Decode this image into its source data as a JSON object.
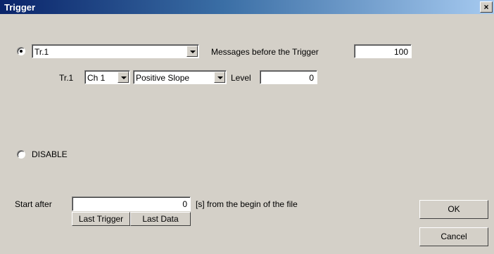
{
  "window": {
    "title": "Trigger",
    "close_glyph": "×"
  },
  "trigger": {
    "selected": true,
    "select_value": "Tr.1",
    "messages_label": "Messages before the Trigger",
    "messages_value": "100",
    "row_label": "Tr.1",
    "channel_value": "Ch 1",
    "slope_value": "Positive Slope",
    "level_label": "Level",
    "level_value": "0"
  },
  "disable": {
    "selected": false,
    "label": "DISABLE"
  },
  "start": {
    "label": "Start after",
    "value": "0",
    "suffix": "[s] from the begin of the file",
    "last_trigger_label": "Last Trigger",
    "last_data_label": "Last Data"
  },
  "buttons": {
    "ok_label": "OK",
    "cancel_label": "Cancel"
  }
}
